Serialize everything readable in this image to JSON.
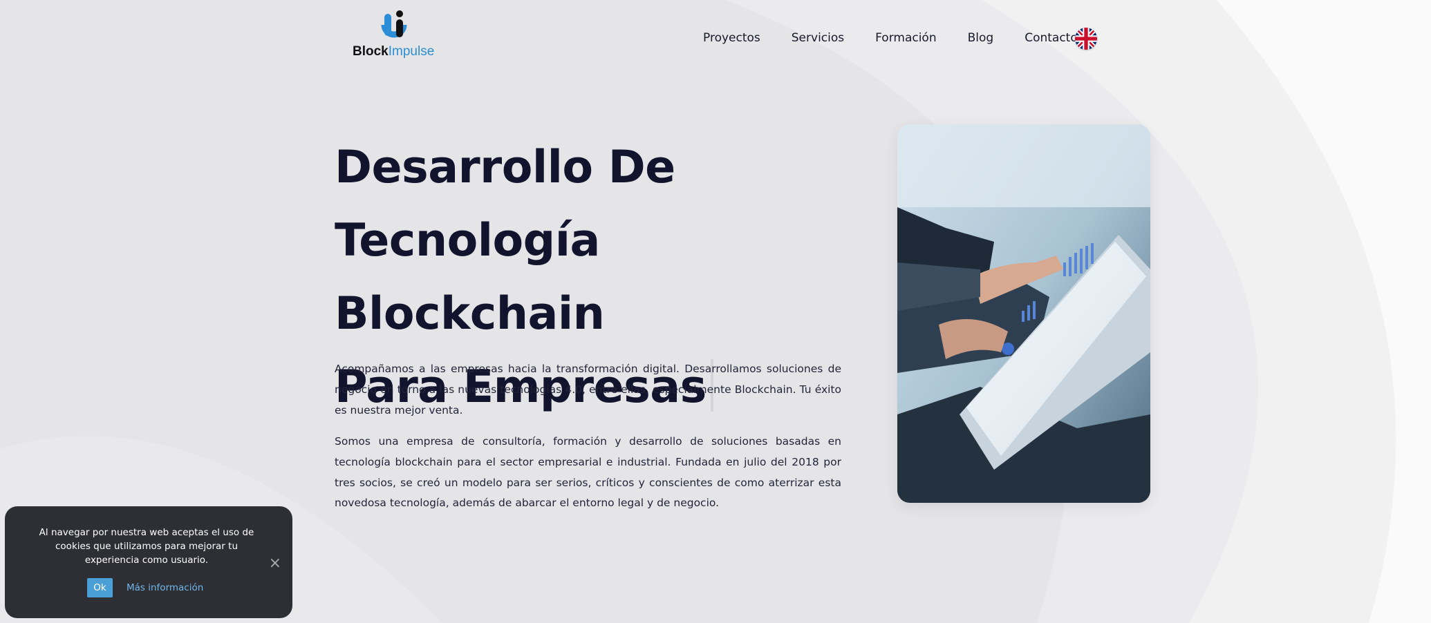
{
  "header": {
    "logo": {
      "part1": "Block",
      "part2": "Impulse"
    },
    "nav": [
      "Proyectos",
      "Servicios",
      "Formación",
      "Blog",
      "Contacto"
    ],
    "language_flag": "uk-flag-icon"
  },
  "hero": {
    "title_line1": "Desarrollo De",
    "title_line2": "Tecnología Blockchain",
    "title_line3": "Para Empresas",
    "paragraph1": "Acompañamos a las empresas hacia la transformación digital. Desarrollamos soluciones de negocio en torno a las nuevas tecnologías 4.0, entre ellas, especialmente Blockchain. Tu éxito es nuestra mejor venta.",
    "paragraph2": "Somos una empresa de consultoría, formación y desarrollo de soluciones basadas en tecnología blockchain para el sector empresarial e industrial. Fundada en julio del 2018 por tres socios, se creó un modelo para ser serios, críticos y conscientes de como aterrizar esta novedosa tecnología, además de abarcar el entorno legal y de negocio."
  },
  "cookie": {
    "text": "Al navegar por nuestra web aceptas el uso de cookies que utilizamos para mejorar tu experiencia como usuario.",
    "ok": "Ok",
    "more": "Más información",
    "close": "×"
  },
  "colors": {
    "heading": "#11142c",
    "brand_blue": "#2b8ed6",
    "cookie_bg": "#2e2f35",
    "cookie_button": "#4a9fd6"
  }
}
